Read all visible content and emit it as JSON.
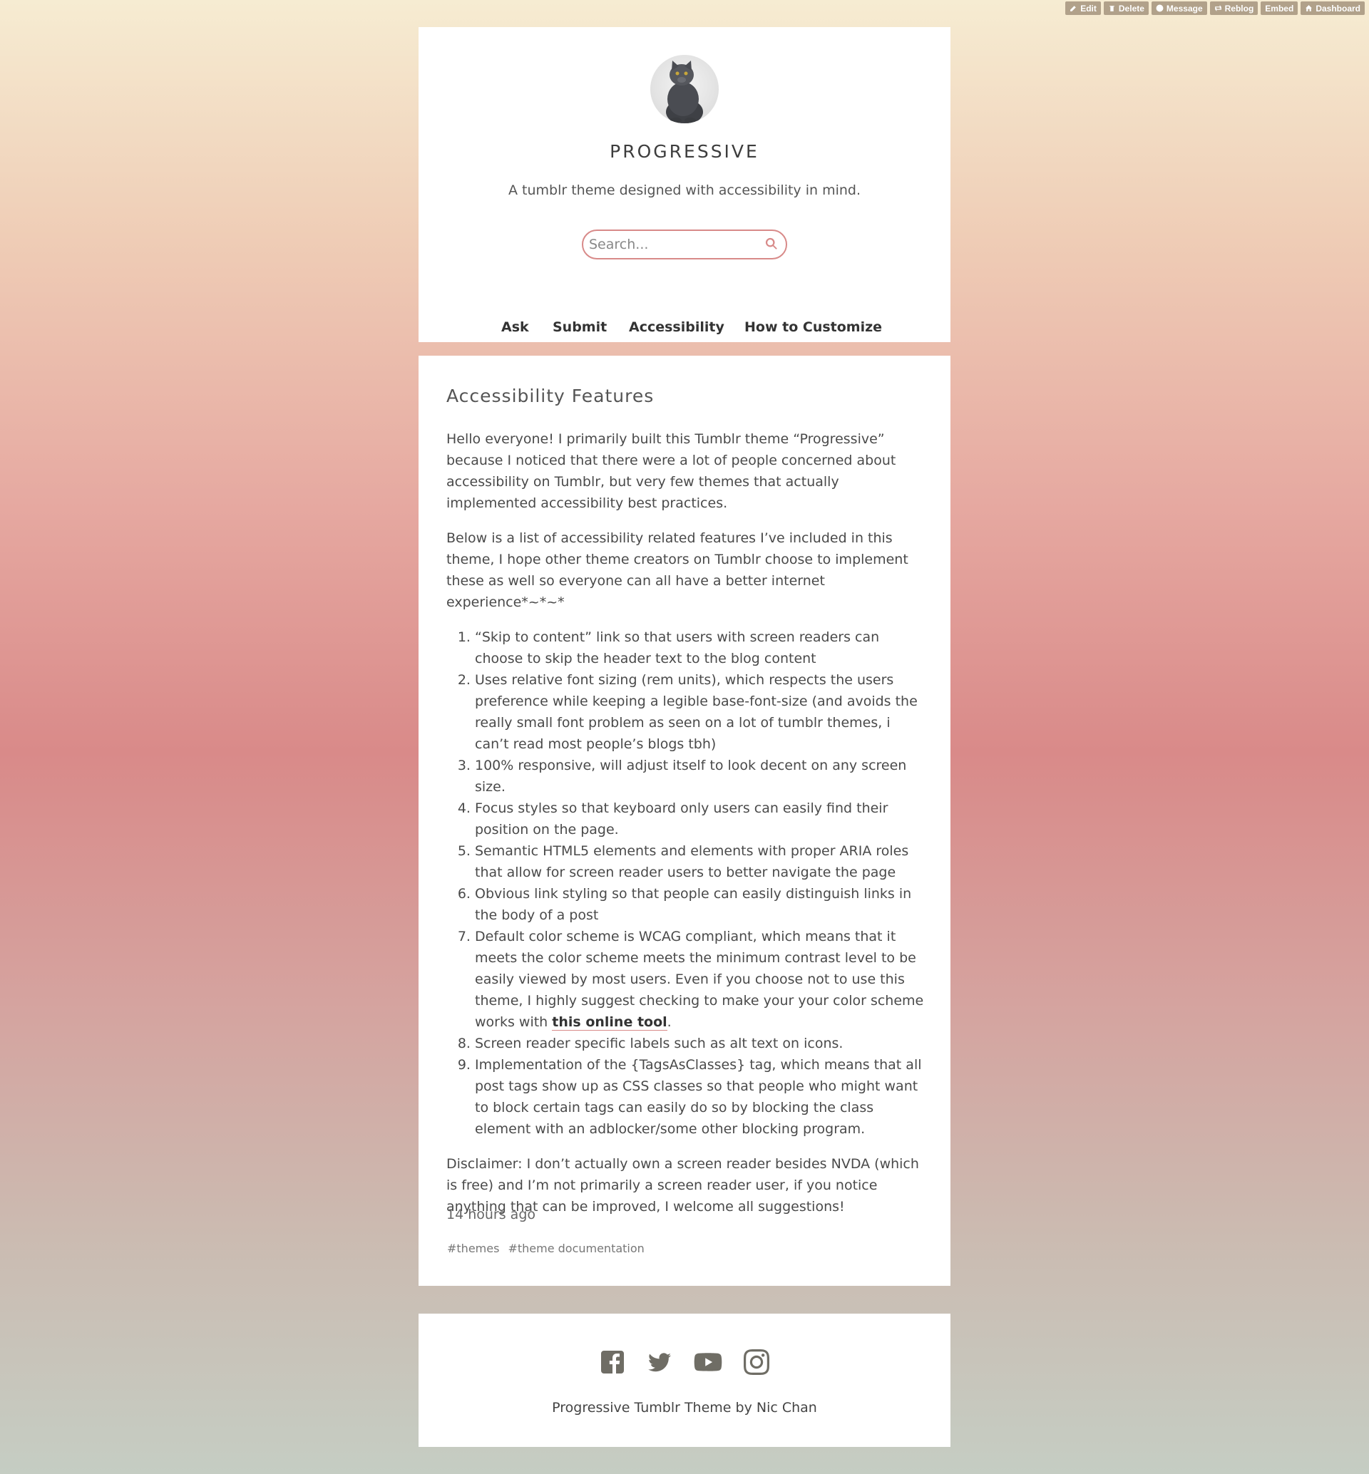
{
  "tumblr_controls": {
    "edit": "Edit",
    "delete": "Delete",
    "message": "Message",
    "reblog": "Reblog",
    "embed": "Embed",
    "dashboard": "Dashboard"
  },
  "header": {
    "title": "PROGRESSIVE",
    "description": "A tumblr theme designed with accessibility in mind.",
    "search_placeholder": "Search...",
    "nav": [
      "Ask",
      "Submit",
      "Accessibility",
      "How to Customize"
    ]
  },
  "post": {
    "title": "Accessibility Features",
    "intro": "Hello everyone! I primarily built this Tumblr theme “Progressive” because I noticed that there were a lot of people concerned about accessibility on Tumblr, but very few themes that actually implemented accessibility best practices.",
    "below": "Below is a list of accessibility related features I’ve included in this theme, I hope other theme creators on Tumblr choose to implement these as well so everyone can all have a better internet experience*~*~*",
    "items": [
      "“Skip to content” link so that users with screen readers can choose to skip the header text to the blog content",
      "Uses relative font sizing (rem units), which respects the users preference while keeping a legible base-font-size (and avoids the really small font problem as seen on a lot of tumblr themes, i can’t read most people’s blogs tbh)",
      "100% responsive, will adjust itself to look decent on any screen size.",
      "Focus styles so that keyboard only users can easily find their position on the page.",
      "Semantic HTML5 elements and elements with proper ARIA roles that allow for screen reader users to better navigate the page",
      "Obvious link styling so that people can easily distinguish links in the body of a post",
      "Default color scheme is WCAG compliant, which means that it meets the color scheme meets the  minimum contrast level to be easily viewed by most users. Even if you choose not to use this theme, I highly suggest checking to make your your color scheme works with ",
      "Screen reader specific labels such as alt text on icons.",
      "Implementation of the {TagsAsClasses} tag, which means that all post tags show up as CSS classes so that people who might want to block certain tags can easily do so by blocking the class element with an adblocker/some other blocking program."
    ],
    "item7_link": "this online tool",
    "item7_end": ".",
    "disclaimer": "Disclaimer: I don’t actually own a screen reader besides NVDA (which is free) and I’m not primarily a screen reader user, if you notice anything that can be improved, I welcome all suggestions!",
    "time": "14 hours ago",
    "tags": [
      "#themes",
      "#theme documentation"
    ]
  },
  "footer": {
    "socials": [
      "facebook-icon",
      "twitter-icon",
      "youtube-icon",
      "instagram-icon"
    ],
    "credit": "Progressive Tumblr Theme by Nic Chan"
  },
  "colors": {
    "accent": "#d88a89",
    "text": "#444444",
    "icon": "#6f6d65"
  }
}
